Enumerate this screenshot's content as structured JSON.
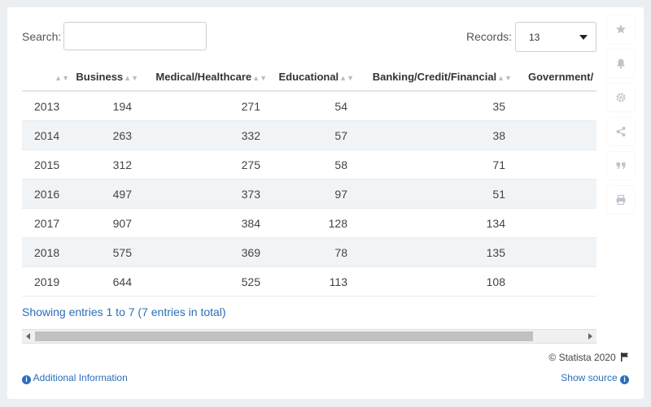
{
  "search": {
    "label": "Search:",
    "value": ""
  },
  "records": {
    "label": "Records:",
    "value": "13"
  },
  "table": {
    "headers": [
      "",
      "Business",
      "Medical/Healthcare",
      "Educational",
      "Banking/Credit/Financial",
      "Government/"
    ],
    "rows": [
      [
        "2013",
        "194",
        "271",
        "54",
        "35",
        ""
      ],
      [
        "2014",
        "263",
        "332",
        "57",
        "38",
        ""
      ],
      [
        "2015",
        "312",
        "275",
        "58",
        "71",
        ""
      ],
      [
        "2016",
        "497",
        "373",
        "97",
        "51",
        ""
      ],
      [
        "2017",
        "907",
        "384",
        "128",
        "134",
        ""
      ],
      [
        "2018",
        "575",
        "369",
        "78",
        "135",
        ""
      ],
      [
        "2019",
        "644",
        "525",
        "113",
        "108",
        ""
      ]
    ]
  },
  "showing": "Showing entries 1 to 7 (7 entries in total)",
  "footer": {
    "copyright": "© Statista 2020",
    "additional_info": "Additional Information",
    "show_source": "Show source"
  },
  "sidebar": {
    "icons": [
      "star-icon",
      "bell-icon",
      "gear-icon",
      "share-icon",
      "quote-icon",
      "print-icon"
    ]
  },
  "colors": {
    "link": "#2a6ebb",
    "stripe": "#f1f4f6",
    "background": "#eceff1"
  },
  "chart_data": {
    "type": "table",
    "columns": [
      "",
      "Business",
      "Medical/Healthcare",
      "Educational",
      "Banking/Credit/Financial",
      "Government/"
    ],
    "categories": [
      "2013",
      "2014",
      "2015",
      "2016",
      "2017",
      "2018",
      "2019"
    ],
    "series": [
      {
        "name": "Business",
        "values": [
          194,
          263,
          312,
          497,
          907,
          575,
          644
        ]
      },
      {
        "name": "Medical/Healthcare",
        "values": [
          271,
          332,
          275,
          373,
          384,
          369,
          525
        ]
      },
      {
        "name": "Educational",
        "values": [
          54,
          57,
          58,
          97,
          128,
          78,
          113
        ]
      },
      {
        "name": "Banking/Credit/Financial",
        "values": [
          35,
          38,
          71,
          51,
          134,
          135,
          108
        ]
      }
    ]
  }
}
